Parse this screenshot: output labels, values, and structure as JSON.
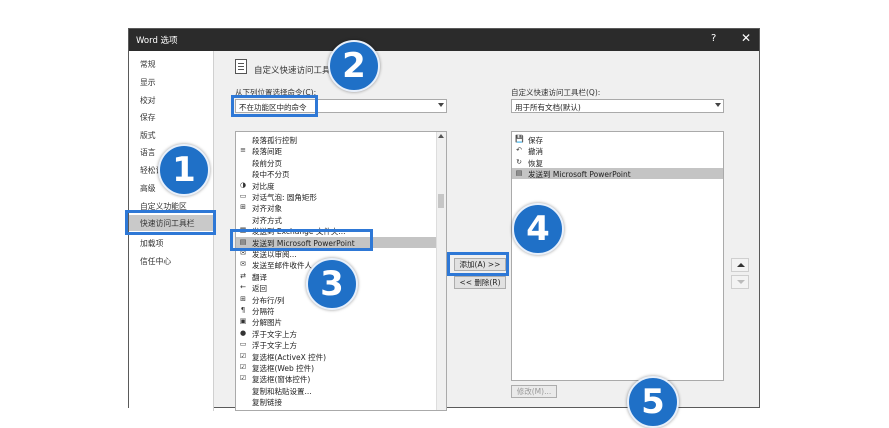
{
  "window": {
    "title": "Word 选项",
    "help": "?",
    "close": "✕"
  },
  "nav": {
    "items": [
      {
        "label": "常规"
      },
      {
        "label": "显示"
      },
      {
        "label": "校对"
      },
      {
        "label": "保存"
      },
      {
        "label": "版式"
      },
      {
        "label": "语言"
      },
      {
        "label": "轻松访问"
      },
      {
        "label": "高级"
      },
      {
        "label": "自定义功能区"
      },
      {
        "label": "快速访问工具栏",
        "active": true
      },
      {
        "label": "加载项"
      },
      {
        "label": "信任中心"
      }
    ]
  },
  "header": {
    "title": "自定义快速访问工具栏。"
  },
  "left_panel": {
    "label": "从下列位置选择命令(C):",
    "combo_value": "不在功能区中的命令",
    "items": [
      {
        "icon": "",
        "label": "段落孤行控制",
        "submenu": false
      },
      {
        "icon": "≡",
        "label": "段落间距",
        "submenu": true
      },
      {
        "icon": "",
        "label": "段前分页",
        "submenu": false
      },
      {
        "icon": "",
        "label": "段中不分页",
        "submenu": false
      },
      {
        "icon": "◑",
        "label": "对比度",
        "submenu": true
      },
      {
        "icon": "▭",
        "label": "对话气泡: 圆角矩形",
        "submenu": false
      },
      {
        "icon": "⊞",
        "label": "对齐对象",
        "submenu": false
      },
      {
        "icon": "",
        "label": "对齐方式",
        "submenu": true
      },
      {
        "icon": "▦",
        "label": "发送到 Exchange 文件夹...",
        "submenu": false
      },
      {
        "icon": "▤",
        "label": "发送到 Microsoft PowerPoint",
        "submenu": false,
        "selected": true
      },
      {
        "icon": "✉",
        "label": "发送以审阅...",
        "submenu": false
      },
      {
        "icon": "✉",
        "label": "发送至邮件收件人",
        "submenu": false
      },
      {
        "icon": "⇄",
        "label": "翻译",
        "submenu": false
      },
      {
        "icon": "←",
        "label": "返回",
        "submenu": false
      },
      {
        "icon": "⊞",
        "label": "分布行/列",
        "submenu": false
      },
      {
        "icon": "¶",
        "label": "分隔符",
        "submenu": false
      },
      {
        "icon": "▣",
        "label": "分解图片",
        "submenu": false
      },
      {
        "icon": "●",
        "label": "浮于文字上方",
        "submenu": false
      },
      {
        "icon": "▭",
        "label": "浮于文字上方",
        "submenu": false
      },
      {
        "icon": "☑",
        "label": "复选框(ActiveX 控件)",
        "submenu": false
      },
      {
        "icon": "☑",
        "label": "复选框(Web 控件)",
        "submenu": false
      },
      {
        "icon": "☑",
        "label": "复选框(窗体控件)",
        "submenu": false
      },
      {
        "icon": "",
        "label": "复制和粘贴设置...",
        "submenu": false
      },
      {
        "icon": "",
        "label": "复制链接",
        "submenu": false
      }
    ]
  },
  "right_panel": {
    "label": "自定义快速访问工具栏(Q):",
    "combo_value": "用于所有文档(默认)",
    "items": [
      {
        "icon": "💾",
        "label": "保存"
      },
      {
        "icon": "↶",
        "label": "撤消"
      },
      {
        "icon": "↻",
        "label": "恢复"
      },
      {
        "icon": "▤",
        "label": "发送到 Microsoft PowerPoint",
        "selected": true
      }
    ],
    "modify_label": "修改(M)..."
  },
  "buttons": {
    "add": "添加(A) >>",
    "remove": "<< 删除(R)"
  },
  "callouts": [
    "1",
    "2",
    "3",
    "4",
    "5"
  ]
}
